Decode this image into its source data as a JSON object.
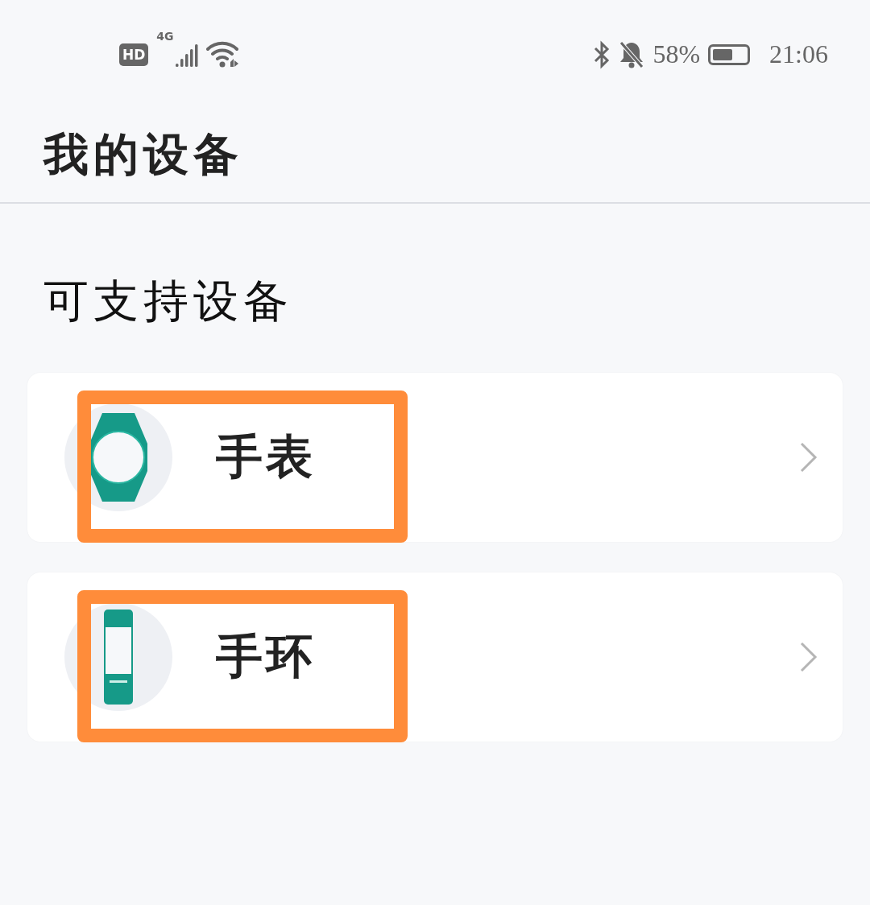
{
  "status_bar": {
    "hd": "HD",
    "network": "4G",
    "battery_text": "58%",
    "time": "21:06"
  },
  "header": {
    "title": "我的设备"
  },
  "section": {
    "title": "可支持设备"
  },
  "devices": [
    {
      "kind": "watch",
      "label": "手表",
      "highlighted": true
    },
    {
      "kind": "band",
      "label": "手环",
      "highlighted": true
    }
  ]
}
